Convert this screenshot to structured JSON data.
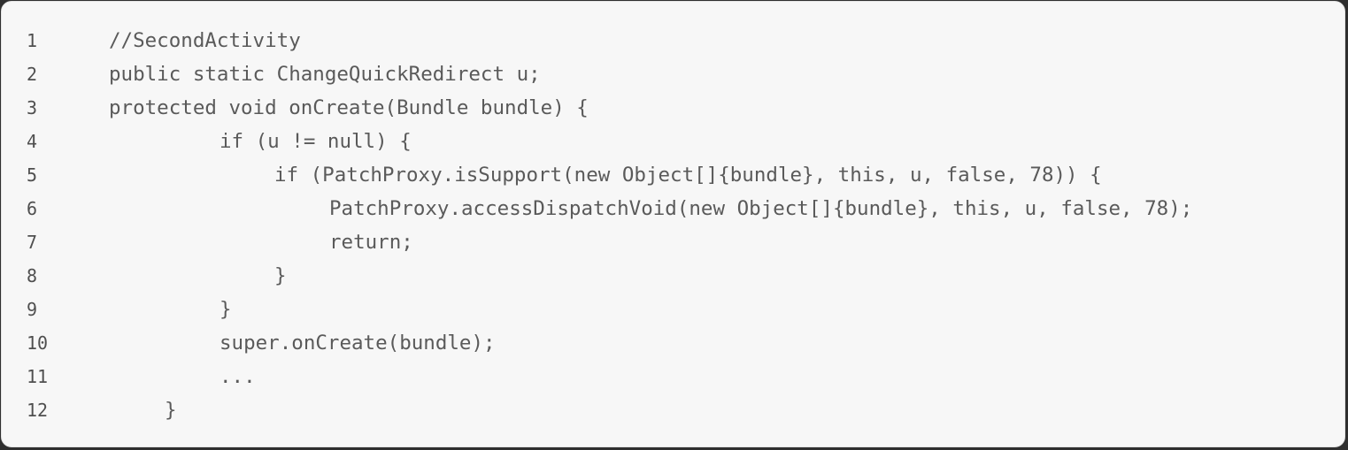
{
  "code_block": {
    "lines": [
      {
        "number": "1",
        "code": "//SecondActivity"
      },
      {
        "number": "2",
        "code": "public static ChangeQuickRedirect u;"
      },
      {
        "number": "3",
        "code": "protected void onCreate(Bundle bundle) {"
      },
      {
        "number": "4",
        "code": "if (u != null) {"
      },
      {
        "number": "5",
        "code": "if (PatchProxy.isSupport(new Object[]{bundle}, this, u, false, 78)) {"
      },
      {
        "number": "6",
        "code": "PatchProxy.accessDispatchVoid(new Object[]{bundle}, this, u, false, 78);"
      },
      {
        "number": "7",
        "code": "return;"
      },
      {
        "number": "8",
        "code": "}"
      },
      {
        "number": "9",
        "code": "}"
      },
      {
        "number": "10",
        "code": "super.onCreate(bundle);"
      },
      {
        "number": "11",
        "code": "..."
      },
      {
        "number": "12",
        "code": "}"
      }
    ]
  }
}
